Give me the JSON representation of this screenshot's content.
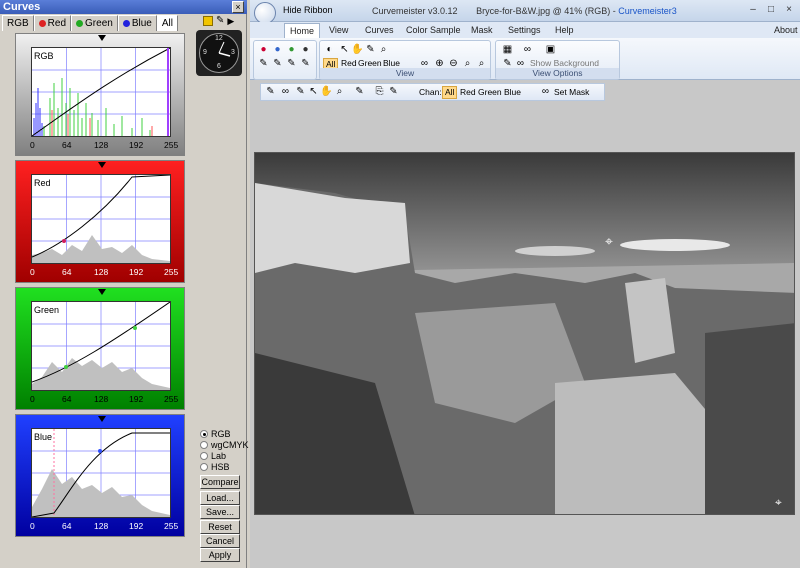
{
  "curves": {
    "title": "Curves",
    "close": "×",
    "tabs": [
      {
        "label": "RGB",
        "color": ""
      },
      {
        "label": "Red",
        "color": "#d22"
      },
      {
        "label": "Green",
        "color": "#2a2"
      },
      {
        "label": "Blue",
        "color": "#22d"
      },
      {
        "label": "All",
        "color": ""
      }
    ],
    "panels": [
      {
        "title": "RGB",
        "ticks": [
          "0",
          "64",
          "128",
          "192",
          "255"
        ],
        "bg": "#808080"
      },
      {
        "title": "Red",
        "ticks": [
          "0",
          "64",
          "128",
          "192",
          "255"
        ],
        "bg": "#e00000"
      },
      {
        "title": "Green",
        "ticks": [
          "0",
          "64",
          "128",
          "192",
          "255"
        ],
        "bg": "#00c000"
      },
      {
        "title": "Blue",
        "ticks": [
          "0",
          "64",
          "128",
          "192",
          "255"
        ],
        "bg": "#0000d0"
      }
    ],
    "clock_numbers": [
      "12",
      "9",
      "3",
      "6"
    ],
    "modes": [
      "RGB",
      "wgCMYK",
      "Lab",
      "HSB"
    ],
    "selected_mode": "RGB",
    "buttons": [
      "Compare",
      "Load...",
      "Save...",
      "Reset",
      "Cancel",
      "Apply"
    ]
  },
  "app": {
    "hide_ribbon": "Hide Ribbon",
    "version": "Curvemeister v3.0.12",
    "document": "Bryce-for-B&W.jpg @ 41% (RGB)",
    "app_name": "Curvemeister3",
    "tabs": [
      "Home",
      "View",
      "Curves",
      "Color Sample",
      "Mask",
      "Settings",
      "Help"
    ],
    "about": "About",
    "ribbon": {
      "channel_buttons": [
        "All",
        "Red",
        "Green",
        "Blue"
      ],
      "view_group": "View",
      "view_options_group": "View Options",
      "show_bg_layers": "Show Background Layers"
    },
    "toolbar": {
      "chan_label": "Chan:",
      "channels": [
        "All",
        "Red",
        "Green",
        "Blue"
      ],
      "set_mask": "Set Mask"
    }
  }
}
